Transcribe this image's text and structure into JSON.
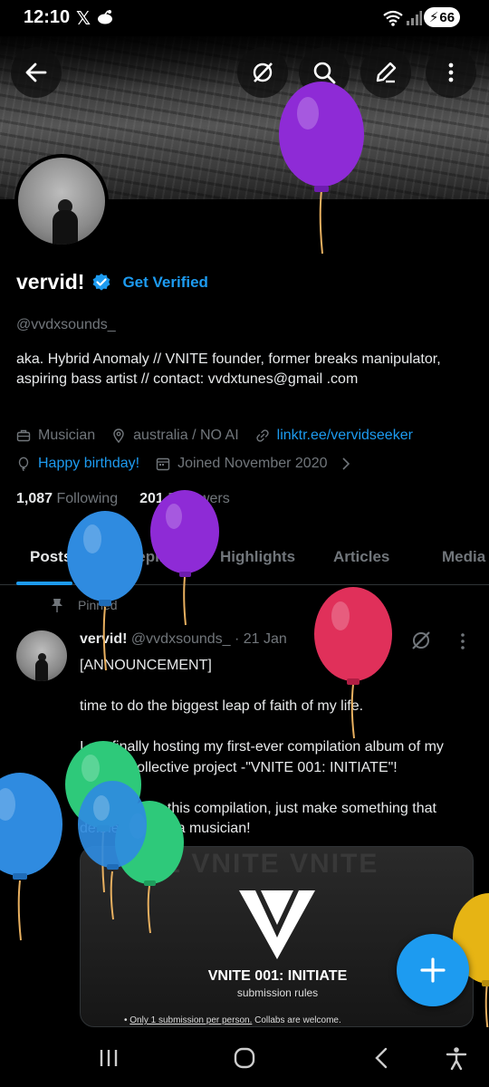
{
  "status_bar": {
    "time": "12:10",
    "x_logo": "𝕏",
    "battery": "66"
  },
  "profile": {
    "name": "vervid!",
    "get_verified": "Get Verified",
    "handle": "@vvdxsounds_",
    "bio": "aka. Hybrid Anomaly // VNITE founder, former breaks manipulator, aspiring bass artist // contact: vvdxtunes@gmail .com",
    "category": "Musician",
    "location": "australia / NO AI",
    "website": "linktr.ee/vervidseeker",
    "birthday": "Happy birthday!",
    "joined": "Joined November 2020",
    "following_count": "1,087",
    "following_label": "Following",
    "followers_count": "201",
    "followers_label": "Followers"
  },
  "tabs": [
    "Posts",
    "Replies",
    "Highlights",
    "Articles",
    "Media"
  ],
  "pinned_post": {
    "pinned_label": "Pinned",
    "author_name": "vervid!",
    "meta": "@vvdxsounds_ · 21 Jan",
    "text": "[ANNOUNCEMENT]\n\ntime to do the biggest leap of faith of my life.\n\nI am finally hosting my first-ever compilation album of my newest collective project -\"VNITE 001: INITIATE\"!\n\nNo theme for this compilation, just make something that defines you as a musician!",
    "media": {
      "watermark": "E VNITE VNITE",
      "title": "VNITE 001: INITIATE",
      "subtitle": "submission rules",
      "rule_underlined": "Only 1 submission per person.",
      "rule_rest": " Collabs are welcome."
    }
  },
  "colors": {
    "accent": "#1d9bf0",
    "background": "#000000",
    "secondary_text": "#71767b",
    "balloon_purple": "#8e2bd6",
    "balloon_blue": "#2f8be0",
    "balloon_red": "#e0305a",
    "balloon_green": "#2ec97a",
    "balloon_yellow": "#e6b414"
  },
  "icons": [
    "back-arrow-icon",
    "grok-icon",
    "search-icon",
    "edit-icon",
    "more-vertical-icon",
    "verified-badge-icon",
    "briefcase-icon",
    "location-pin-icon",
    "link-icon",
    "balloon-icon",
    "calendar-icon",
    "chevron-right-icon",
    "pin-icon",
    "compose-plus-icon",
    "recents-icon",
    "home-icon",
    "back-icon",
    "accessibility-icon"
  ]
}
